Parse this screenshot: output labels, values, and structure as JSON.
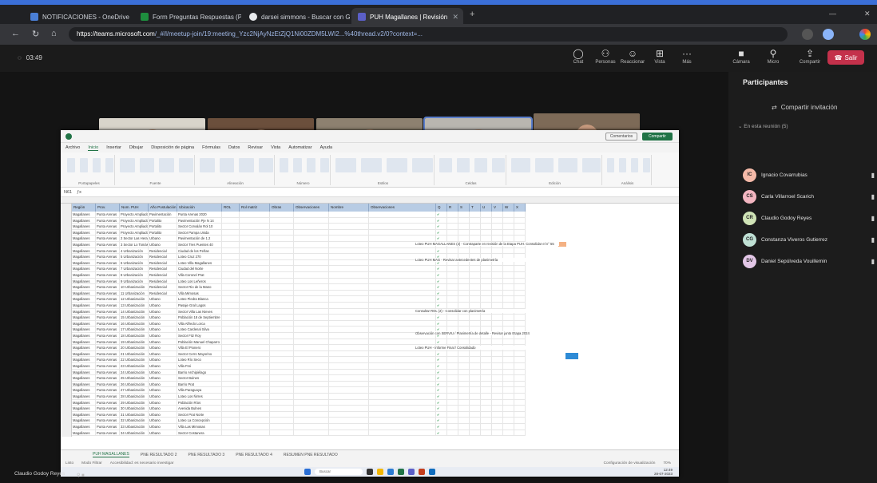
{
  "browser": {
    "tabs": [
      {
        "label": "NOTIFICACIONES - OneDrive",
        "color": "#4a7fd6"
      },
      {
        "label": "Form Preguntas Respuestas (PA...",
        "color": "#1e8e3e"
      },
      {
        "label": "darsei simmons - Buscar con G...",
        "color": "#e8eaed"
      },
      {
        "label": "PUH Magallanes | Revisión",
        "color": "#5b5fc7"
      }
    ],
    "url_host": "https://teams.microsoft.com",
    "url_rest": "/_#/l/meetup-join/19:meeting_Yzc2NjAyNzEtZjQ1Ni00ZDM5LWI2...%40thread.v2/0?context=..."
  },
  "meeting": {
    "timer": "03:49",
    "tools": [
      {
        "label": "Chat",
        "icon": "chat-icon",
        "glyph": "◯"
      },
      {
        "label": "Personas",
        "icon": "people-icon",
        "glyph": "⚇"
      },
      {
        "label": "Reaccionar",
        "icon": "reaction-icon",
        "glyph": "☺"
      },
      {
        "label": "Vista",
        "icon": "view-icon",
        "glyph": "⊞"
      },
      {
        "label": "Más",
        "icon": "more-icon",
        "glyph": "···"
      },
      {
        "label": "Cámara",
        "icon": "camera-icon",
        "glyph": "■"
      },
      {
        "label": "Micro",
        "icon": "mic-icon",
        "glyph": "⚲"
      },
      {
        "label": "Compartir",
        "icon": "share-icon",
        "glyph": "⇪"
      }
    ],
    "leave_label": "Salir",
    "video_tiles": [
      {
        "name": "Claudio Godoy Reyes",
        "wall": "#d9d4ca",
        "shirt": "#b02a2a",
        "active": false
      },
      {
        "name": "Constanza Viveros Gutierrez",
        "wall": "#6b4f3c",
        "shirt": "#2d2d2d",
        "active": false
      },
      {
        "name": "Carla Villarroel Scarich",
        "wall": "#8d8170",
        "shirt": "#3a3a3a",
        "active": false
      },
      {
        "name": "Daniel Sepúlveda Vouillemin",
        "wall": "#b9b6b0",
        "shirt": "#2a2f3a",
        "active": true
      },
      {
        "name": "Ignacio Covarrubias",
        "wall": "#7d6a57",
        "shirt": "#3b4048",
        "active": false
      }
    ],
    "footer_name": "Claudio Godoy Reyes"
  },
  "participants": {
    "title": "Participantes",
    "invite": "Compartir invitación",
    "in_meeting": "En esta reunión (5)",
    "list": [
      {
        "initials": "IC",
        "name": "Ignacio Covarrubias",
        "color": "#f4b9a8"
      },
      {
        "initials": "CS",
        "name": "Carla Villarroel Scarich",
        "color": "#f3b6c1"
      },
      {
        "initials": "CR",
        "name": "Claudio Godoy Reyes",
        "color": "#cfe3b6"
      },
      {
        "initials": "CG",
        "name": "Constanza Viveros Gutierrez",
        "color": "#bfe0d4"
      },
      {
        "initials": "DV",
        "name": "Daniel Sepúlveda Vouillemin",
        "color": "#e2c6e6"
      }
    ]
  },
  "excel": {
    "menu": [
      "Archivo",
      "Inicio",
      "Insertar",
      "Dibujar",
      "Disposición de página",
      "Fórmulas",
      "Datos",
      "Revisar",
      "Vista",
      "Automatizar",
      "Ayuda"
    ],
    "active_menu": "Inicio",
    "comments_label": "Comentarios",
    "share_label": "Compartir",
    "ribbon_groups": [
      "Portapapeles",
      "Fuente",
      "Alineación",
      "Número",
      "Estilos",
      "Celdas",
      "Edición",
      "Análisis"
    ],
    "cell_ref": "N61",
    "headers": [
      "Región",
      "Prov.",
      "Nom. PUH",
      "Año Postulación",
      "Ubicación",
      "ROL",
      "Rol matriz",
      "Obras",
      "Observaciones",
      "Nombre",
      "Observaciones",
      "Q",
      "R",
      "S",
      "T",
      "U",
      "V",
      "W",
      "X"
    ],
    "rows": [
      [
        "Magallanes",
        "Punta Arenas",
        "Proyecto Ampliado",
        "Pavimentación",
        "Punta Arenas 2020"
      ],
      [
        "Magallanes",
        "Punta Arenas",
        "Proyecto Ampliado",
        "Portalito",
        "Pavimentación Pje N 14"
      ],
      [
        "Magallanes",
        "Punta Arenas",
        "Proyecto Ampliado",
        "Portalito",
        "Sector Corvalán Rol 10"
      ],
      [
        "Magallanes",
        "Punta Arenas",
        "Proyecto Ampliado",
        "Portalito",
        "Sector Pampa Unida"
      ],
      [
        "Magallanes",
        "Punta Arenas",
        "2 Sector Las Heras",
        "Urbano",
        "Pavimentación de 1.2"
      ],
      [
        "Magallanes",
        "Punta Arenas",
        "3 Sector Lo Tomás",
        "Urbano",
        "Sector Tres Puentes 40"
      ],
      [
        "Magallanes",
        "Punta Arenas",
        "4 Urbanización",
        "Residencial",
        "Ciudad de los Peñas"
      ],
      [
        "Magallanes",
        "Punta Arenas",
        "5 Urbanización",
        "Residencial",
        "Loteo Cruz 270"
      ],
      [
        "Magallanes",
        "Punta Arenas",
        "6 Urbanización",
        "Residencial",
        "Loteo Villa Magallanes"
      ],
      [
        "Magallanes",
        "Punta Arenas",
        "7 Urbanización",
        "Residencial",
        "Ciudad del Norte"
      ],
      [
        "Magallanes",
        "Punta Arenas",
        "8 Urbanización",
        "Residencial",
        "Villa Coronel Prat"
      ],
      [
        "Magallanes",
        "Punta Arenas",
        "9 Urbanización",
        "Residencial",
        "Loteo Los Leñeros"
      ],
      [
        "Magallanes",
        "Punta Arenas",
        "10 Urbanización",
        "Residencial",
        "Sector Rio de la Mano"
      ],
      [
        "Magallanes",
        "Punta Arenas",
        "11 Urbanización",
        "Residencial",
        "Villa Mimosas"
      ],
      [
        "Magallanes",
        "Punta Arenas",
        "12 Urbanización",
        "Urbano",
        "Loteo Piedra Blanca"
      ],
      [
        "Magallanes",
        "Punta Arenas",
        "13 Urbanización",
        "Urbano",
        "Pasaje Gral Lagos"
      ],
      [
        "Magallanes",
        "Punta Arenas",
        "14 Urbanización",
        "Urbano",
        "Sector Villa Las Nieves"
      ],
      [
        "Magallanes",
        "Punta Arenas",
        "15 Urbanización",
        "Urbano",
        "Población 18 de Septiembre"
      ],
      [
        "Magallanes",
        "Punta Arenas",
        "16 Urbanización",
        "Urbano",
        "Villa Alfredo Lorca"
      ],
      [
        "Magallanes",
        "Punta Arenas",
        "17 Urbanización",
        "Urbano",
        "Loteo Cardenal Silva"
      ],
      [
        "Magallanes",
        "Punta Arenas",
        "18 Urbanización",
        "Urbano",
        "Sector Fitz Roy"
      ],
      [
        "Magallanes",
        "Punta Arenas",
        "19 Urbanización",
        "Urbano",
        "Población Manuel Chaparro"
      ],
      [
        "Magallanes",
        "Punta Arenas",
        "20 Urbanización",
        "Urbano",
        "Villa El Pionero"
      ],
      [
        "Magallanes",
        "Punta Arenas",
        "21 Urbanización",
        "Urbano",
        "Sector Cerro Mayorino"
      ],
      [
        "Magallanes",
        "Punta Arenas",
        "22 Urbanización",
        "Urbano",
        "Loteo Río Seco"
      ],
      [
        "Magallanes",
        "Punta Arenas",
        "23 Urbanización",
        "Urbano",
        "Villa Frei"
      ],
      [
        "Magallanes",
        "Punta Arenas",
        "24 Urbanización",
        "Urbano",
        "Barrio Archipiélago"
      ],
      [
        "Magallanes",
        "Punta Arenas",
        "25 Urbanización",
        "Urbano",
        "Sector Bulnes"
      ],
      [
        "Magallanes",
        "Punta Arenas",
        "26 Urbanización",
        "Urbano",
        "Barrio Prat"
      ],
      [
        "Magallanes",
        "Punta Arenas",
        "27 Urbanización",
        "Urbano",
        "Villa Paraguaya"
      ],
      [
        "Magallanes",
        "Punta Arenas",
        "28 Urbanización",
        "Urbano",
        "Loteo Los Ñirres"
      ],
      [
        "Magallanes",
        "Punta Arenas",
        "29 Urbanización",
        "Urbano",
        "Población Ríos"
      ],
      [
        "Magallanes",
        "Punta Arenas",
        "30 Urbanización",
        "Urbano",
        "Avenida Bulnes"
      ],
      [
        "Magallanes",
        "Punta Arenas",
        "31 Urbanización",
        "Urbano",
        "Sector Prat Norte"
      ],
      [
        "Magallanes",
        "Punta Arenas",
        "32 Urbanización",
        "Urbano",
        "Loteo La Concepción"
      ],
      [
        "Magallanes",
        "Punta Arenas",
        "33 Urbanización",
        "Urbano",
        "Villa Las Mimosas"
      ],
      [
        "Magallanes",
        "Punta Arenas",
        "34 Urbanización",
        "Urbano",
        "Sector Costanera"
      ]
    ],
    "notes": [
      "Loteo PUH MAGALLANES (2) - Contraparte en revisión de la Etapa PUH. Consolidar el n° 55",
      "Loteo PUH MAG - Revisar antecedentes de planimetría",
      "Consultar ROL (2) - Consolidar con planimetría",
      "Observación con SERVIU / Planimetría de detalle - Revisar junto Etapa 2024",
      "Loteo PUH - Informe Final / Consolidado"
    ],
    "sheet_tabs": [
      "PUH MAGALLANES",
      "PNE RESULTADO 2",
      "PNE RESULTADO 3",
      "PNE RESULTADO 4",
      "RESUMEN PNE RESULTADO"
    ],
    "active_sheet": "PUH MAGALLANES",
    "status_left": "Listo",
    "status_filter": "Modo Filtrar",
    "status_access": "Accesibilidad: es necesario investigar",
    "status_right": "Configuración de visualización",
    "zoom": "70%",
    "taskbar_search": "Buscar",
    "clock_time": "12:49",
    "clock_date": "28-07-2023"
  }
}
